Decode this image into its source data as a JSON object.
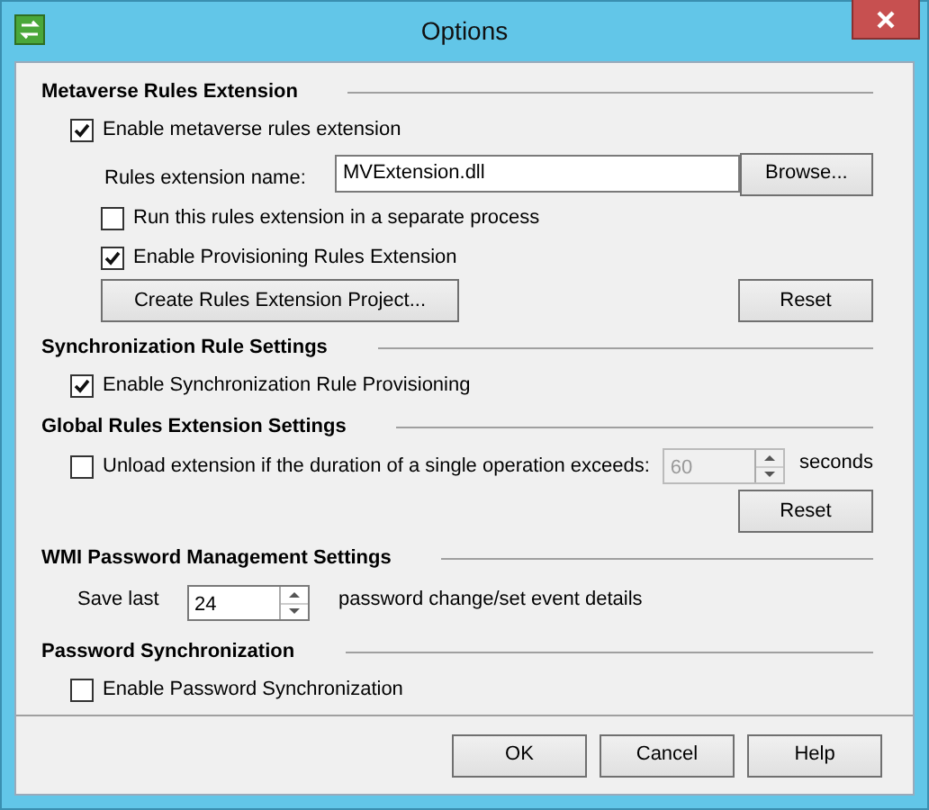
{
  "window": {
    "title": "Options"
  },
  "sections": [
    {
      "title": "Metaverse Rules Extension",
      "items": [
        {
          "kind": "checkbox",
          "label": "Enable metaverse rules extension",
          "checked": true,
          "children": [
            {
              "kind": "file-field",
              "label": "Rules extension name:",
              "value": "MVExtension.dll",
              "button": "Browse..."
            },
            {
              "kind": "checkbox",
              "label": "Run this rules extension in a separate process",
              "checked": false
            },
            {
              "kind": "checkbox",
              "label": "Enable Provisioning Rules Extension",
              "checked": true
            },
            {
              "kind": "button-row",
              "buttons": [
                "Create Rules Extension Project...",
                "Reset"
              ]
            }
          ]
        }
      ]
    },
    {
      "title": "Synchronization Rule Settings",
      "items": [
        {
          "kind": "checkbox",
          "label": "Enable Synchronization Rule Provisioning",
          "checked": true
        }
      ]
    },
    {
      "title": "Global Rules Extension Settings",
      "items": [
        {
          "kind": "timeout",
          "label": "Unload extension if the duration of a single operation exceeds:",
          "checked": false,
          "value": "60",
          "disabled": true,
          "unit": "seconds"
        },
        {
          "kind": "button-row",
          "buttons": [
            "Reset"
          ]
        }
      ]
    },
    {
      "title": "WMI Password Management Settings",
      "items": [
        {
          "kind": "spin",
          "label": "Save last",
          "value": "24",
          "suffix": "password change/set event details"
        }
      ]
    },
    {
      "title": "Password Synchronization",
      "items": [
        {
          "kind": "checkbox",
          "label": "Enable Password Synchronization",
          "checked": false
        }
      ]
    }
  ],
  "footer_buttons": [
    "OK",
    "Cancel",
    "Help"
  ]
}
